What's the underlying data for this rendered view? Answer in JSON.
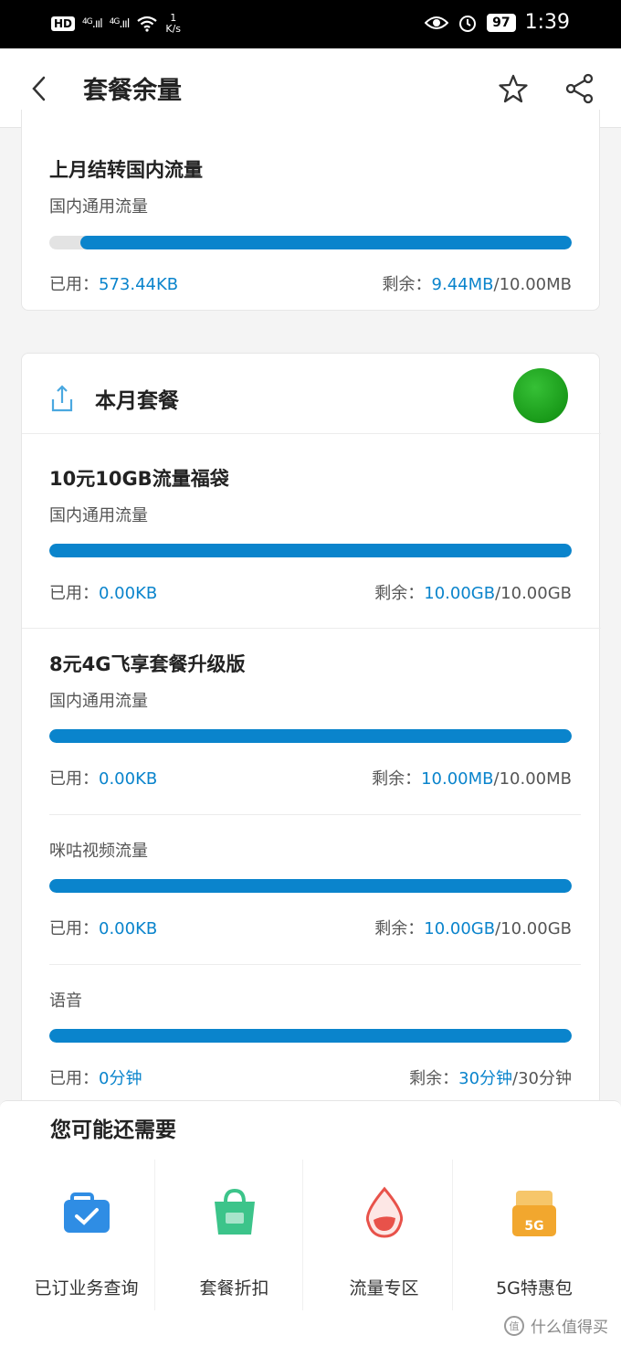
{
  "status_bar": {
    "hd": "HD",
    "signal_1": "4G",
    "signal_2": "4G",
    "speed_value": "1",
    "speed_unit": "K/s",
    "battery": "97",
    "time": "1:39"
  },
  "header": {
    "title": "套餐余量"
  },
  "carryover": {
    "title": "上月结转国内流量",
    "sub_label": "国内通用流量",
    "used_prefix": "已用：",
    "used_value": "573.44KB",
    "remain_prefix": "剩余：",
    "remain_value": "9.44MB",
    "remain_total": "/10.00MB",
    "remaining_fraction": 0.94
  },
  "month": {
    "title": "本月套餐",
    "packages": [
      {
        "title": "10元10GB流量福袋",
        "items": [
          {
            "label": "国内通用流量",
            "used_prefix": "已用：",
            "used_value": "0.00KB",
            "remain_prefix": "剩余：",
            "remain_value": "10.00GB",
            "remain_total": "/10.00GB",
            "remaining_fraction": 1.0
          }
        ]
      },
      {
        "title": "8元4G飞享套餐升级版",
        "items": [
          {
            "label": "国内通用流量",
            "used_prefix": "已用：",
            "used_value": "0.00KB",
            "remain_prefix": "剩余：",
            "remain_value": "10.00MB",
            "remain_total": "/10.00MB",
            "remaining_fraction": 1.0
          },
          {
            "label": "咪咕视频流量",
            "used_prefix": "已用：",
            "used_value": "0.00KB",
            "remain_prefix": "剩余：",
            "remain_value": "10.00GB",
            "remain_total": "/10.00GB",
            "remaining_fraction": 1.0
          },
          {
            "label": "语音",
            "used_prefix": "已用：",
            "used_value": "0分钟",
            "remain_prefix": "剩余：",
            "remain_value": "30分钟",
            "remain_total": "/30分钟",
            "remaining_fraction": 1.0
          }
        ]
      }
    ]
  },
  "recommend": {
    "title": "您可能还需要",
    "services": [
      {
        "label": "已订业务查询",
        "icon": "briefcase-check-icon",
        "color": "#2f8de4"
      },
      {
        "label": "套餐折扣",
        "icon": "shopping-bag-icon",
        "color": "#3cc48a"
      },
      {
        "label": "流量专区",
        "icon": "water-drop-icon",
        "color": "#e8524a"
      },
      {
        "label": "5G特惠包",
        "icon": "5g-gift-icon",
        "color": "#f2a72e"
      }
    ]
  },
  "watermark": {
    "text": "什么值得买"
  },
  "colors": {
    "accent": "#0a84cc",
    "track": "#e3e3e3",
    "green": "#1fa31f"
  }
}
